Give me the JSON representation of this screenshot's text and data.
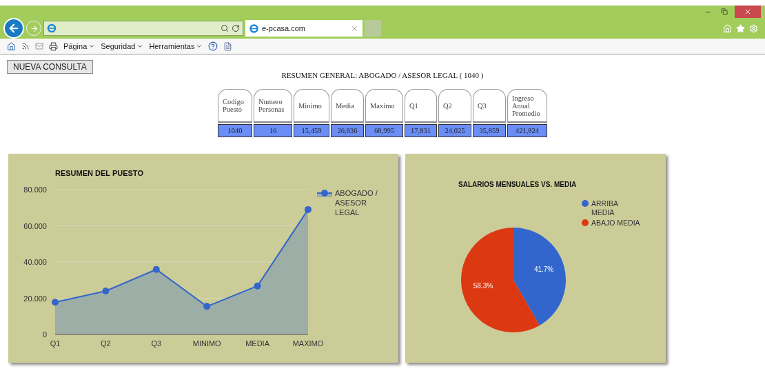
{
  "browser": {
    "tab": {
      "title": "e-pcasa.com",
      "selected": true
    },
    "menus": [
      "Página",
      "Seguridad",
      "Herramientas"
    ]
  },
  "page": {
    "new_query_button": "NUEVA CONSULTA",
    "title": "RESUMEN GENERAL: ABOGADO / ASESOR LEGAL ( 1040 )",
    "table": {
      "columns": [
        "Codigo Puesto",
        "Numero Personas",
        "Minimo",
        "Media",
        "Maximo",
        "Q1",
        "Q2",
        "Q3",
        "Ingreso Anual Promedio"
      ],
      "rows": [
        [
          "1040",
          "16",
          "15,459",
          "26,836",
          "68,995",
          "17,831",
          "24,025",
          "35,859",
          "421,824"
        ]
      ]
    },
    "line_chart": {
      "chart_data": {
        "type": "area",
        "title": "RESUMEN DEL PUESTO",
        "categories": [
          "Q1",
          "Q2",
          "Q3",
          "MINIMO",
          "MEDIA",
          "MAXIMO"
        ],
        "series": [
          {
            "name": "ABOGADO / ASESOR LEGAL",
            "color": "#3366cc",
            "values": [
              17.8,
              24.0,
              35.9,
              15.5,
              26.8,
              69.0
            ]
          }
        ],
        "ylim": [
          0,
          80
        ],
        "grid": true,
        "yticks": [
          {
            "value": 0,
            "label": "0"
          },
          {
            "value": 20,
            "label": "20.000"
          },
          {
            "value": 40,
            "label": "40.000"
          },
          {
            "value": 60,
            "label": "60.000"
          },
          {
            "value": 80,
            "label": "80.000"
          }
        ]
      }
    },
    "pie_chart": {
      "chart_data": {
        "type": "pie",
        "title": "SALARIOS MENSUALES VS. MEDIA",
        "categories": [
          "ARRIBA MEDIA",
          "ABAJO MEDIA"
        ],
        "series": [
          {
            "values": [
              41.7,
              58.3
            ],
            "colors": [
              "#3366cc",
              "#dc3912"
            ]
          }
        ],
        "value_labels": [
          "41.7%",
          "58.3%"
        ],
        "legend": "right"
      }
    }
  }
}
